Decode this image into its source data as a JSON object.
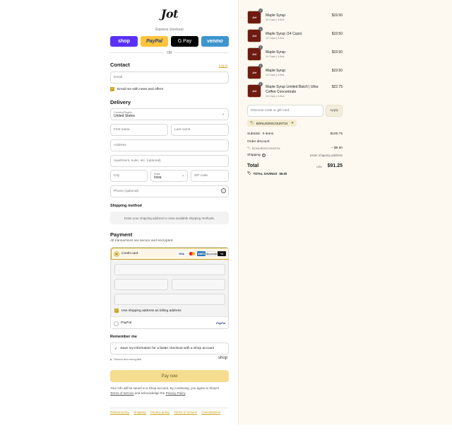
{
  "brand": {
    "logo_text": "Jot"
  },
  "express": {
    "label": "Express checkout",
    "buttons": [
      {
        "label": "shop",
        "color": "#5a31f4"
      },
      {
        "label": "PayPal",
        "color": "#ffc439"
      },
      {
        "label": "G Pay",
        "color": "#000000"
      },
      {
        "label": "venmo",
        "color": "#3d95ce"
      }
    ],
    "or": "OR"
  },
  "contact": {
    "title": "Contact",
    "login": "Log in",
    "email_placeholder": "Email",
    "news_label": "Email me with news and offers"
  },
  "delivery": {
    "title": "Delivery",
    "country_label": "Country/Region",
    "country_value": "United States",
    "first_name": "First name",
    "last_name": "Last name",
    "address": "Address",
    "apartment": "Apartment, suite, etc. (optional)",
    "city": "City",
    "state_label": "State",
    "state_value": "Iowa",
    "zip": "ZIP code",
    "phone": "Phone (optional)"
  },
  "shipping": {
    "title": "Shipping method",
    "message": "Enter your shipping address to view available shipping methods."
  },
  "payment": {
    "title": "Payment",
    "subtitle": "All transactions are secure and encrypted.",
    "credit_card": "Credit card",
    "card_logos": [
      "VISA",
      "MC",
      "AMEX",
      "DISCOVER",
      "+4"
    ],
    "billing_label": "Use shipping address as billing address",
    "paypal": "PayPal",
    "paypal_logo": "PayPal"
  },
  "remember": {
    "title": "Remember me",
    "save_label": "Save my information for a faster checkout with a Shop account",
    "secure": "Secure and encrypted",
    "shop_logo": "shop"
  },
  "pay_button": "Pay now",
  "legal": {
    "line1": "Your info will be saved to a Shop account. By continuing, you agree to Shop's",
    "terms": "Terms of Service",
    "and": " and acknowledge the ",
    "privacy": "Privacy Policy",
    "end": "."
  },
  "footer_links": [
    "Refund policy",
    "Shipping",
    "Privacy policy",
    "Terms of service",
    "Cancellations"
  ],
  "cart": {
    "items": [
      {
        "qty": "1",
        "name": "Maple Syrup",
        "sub": "14 Cups | 4.8oz",
        "price": "$19.50"
      },
      {
        "qty": "1",
        "name": "Maple Syrup (14 Cups)",
        "sub": "14 Cups | 4.8oz",
        "price": "$19.50"
      },
      {
        "qty": "1",
        "name": "Maple Syrup",
        "sub": "14 Cups | 4.8oz",
        "price": "$19.50"
      },
      {
        "qty": "1",
        "name": "Maple Syrup",
        "sub": "14 Cups | 4.8oz",
        "price": "$19.50"
      },
      {
        "qty": "1",
        "name": "Maple Syrup Limited Batch | Ultra Coffee Concentrate",
        "sub": "14 Cups | 4.8oz",
        "price": "$22.75"
      }
    ],
    "thumb_text": "Jot",
    "discount_placeholder": "Discount code or gift card",
    "apply": "Apply",
    "code": "BONUSDISCOUNT24",
    "subtotal_label": "Subtotal · 5 items",
    "subtotal_value": "$100.75",
    "order_discount": "Order discount",
    "discount_code": "BONUSDISCOUNT24",
    "discount_value": "– $9.50",
    "shipping_label": "Shipping",
    "shipping_value": "Enter shipping address",
    "total_label": "Total",
    "currency": "USD",
    "total_value": "$91.25",
    "savings_label": "TOTAL SAVINGS",
    "savings_value": "$9.50"
  }
}
